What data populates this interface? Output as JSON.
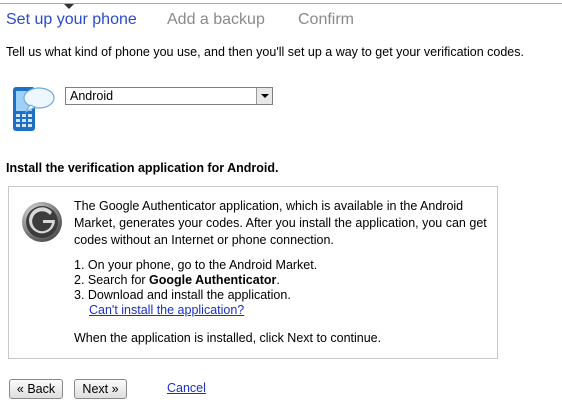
{
  "steps": [
    {
      "label": "Set up your phone",
      "active": true
    },
    {
      "label": "Add a backup",
      "active": false
    },
    {
      "label": "Confirm",
      "active": false
    }
  ],
  "intro": "Tell us what kind of phone you use, and then you'll set up a way to get your verification codes.",
  "phone_select": {
    "value": "Android"
  },
  "heading": "Install the verification application for Android.",
  "instructions": {
    "paragraph": "The Google Authenticator application, which is available in the Android Market, generates your codes. After you install the application, you can get codes without an Internet or phone connection.",
    "step1": "1. On your phone, go to the Android Market.",
    "step2_prefix": "2. Search for ",
    "step2_bold": "Google Authenticator",
    "step2_suffix": ".",
    "step3": "3. Download and install the application.",
    "help_link": "Can't install the application?",
    "final": "When the application is installed, click Next to continue."
  },
  "buttons": {
    "back": "« Back",
    "next": "Next »",
    "cancel": "Cancel"
  },
  "icons": {
    "phone": "android-phone-icon",
    "logo": "google-g-logo-icon"
  },
  "colors": {
    "active_step": "#2a4bcc",
    "inactive_step": "#8a8a8a",
    "link": "#1a2fcc"
  }
}
